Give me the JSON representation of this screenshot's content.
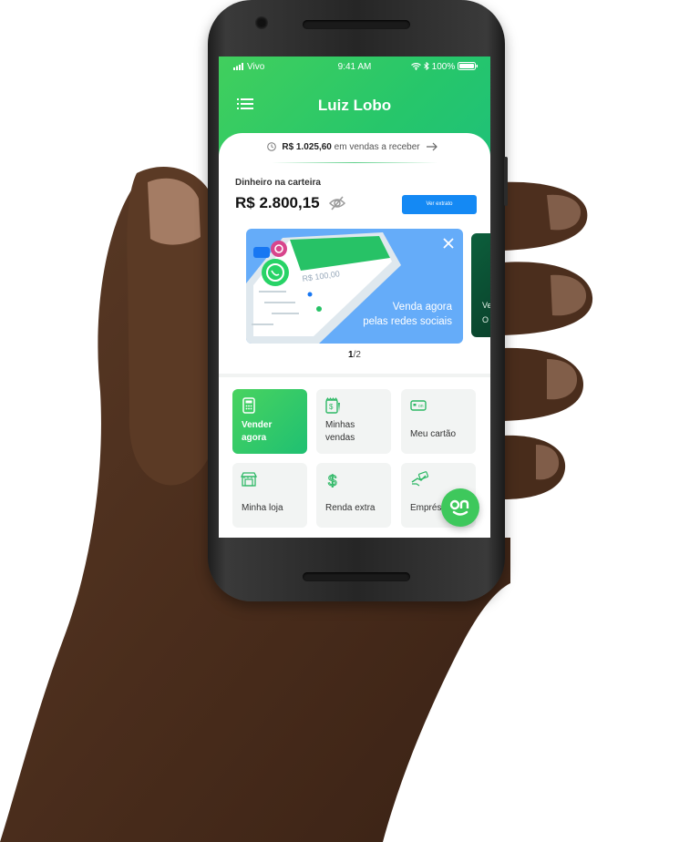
{
  "status_bar": {
    "carrier": "Vivo",
    "time": "9:41 AM",
    "battery": "100%"
  },
  "header": {
    "title": "Luiz Lobo"
  },
  "receivable": {
    "amount": "R$ 1.025,60",
    "text": "em vendas a receber"
  },
  "wallet": {
    "label": "Dinheiro na carteira",
    "amount": "R$ 2.800,15",
    "statement_button": "Ver extrato"
  },
  "banner": {
    "text_line1": "Venda agora",
    "text_line2": "pelas redes sociais",
    "next_preview_line1": "Ve",
    "next_preview_line2": "O",
    "pager_current": "1",
    "pager_total": "/2"
  },
  "grid": [
    {
      "label_line1": "Vender",
      "label_line2": "agora",
      "icon": "calculator-icon"
    },
    {
      "label_line1": "Minhas",
      "label_line2": "vendas",
      "icon": "receipt-icon"
    },
    {
      "label_line1": "Meu cartão",
      "label_line2": "",
      "icon": "card-icon"
    },
    {
      "label_line1": "Minha loja",
      "label_line2": "",
      "icon": "store-icon"
    },
    {
      "label_line1": "Renda extra",
      "label_line2": "",
      "icon": "dollar-icon"
    },
    {
      "label_line1": "Empréstimo",
      "label_line2": "",
      "icon": "loan-icon"
    }
  ],
  "colors": {
    "brand_green": "#2ec866",
    "button_blue": "#1489f4",
    "banner_blue": "#65acf9"
  },
  "icons": [
    "menu-icon",
    "clock-icon",
    "arrow-right-icon",
    "eye-off-icon",
    "close-icon",
    "on-logo-icon",
    "wifi-icon",
    "bluetooth-icon",
    "battery-icon"
  ]
}
